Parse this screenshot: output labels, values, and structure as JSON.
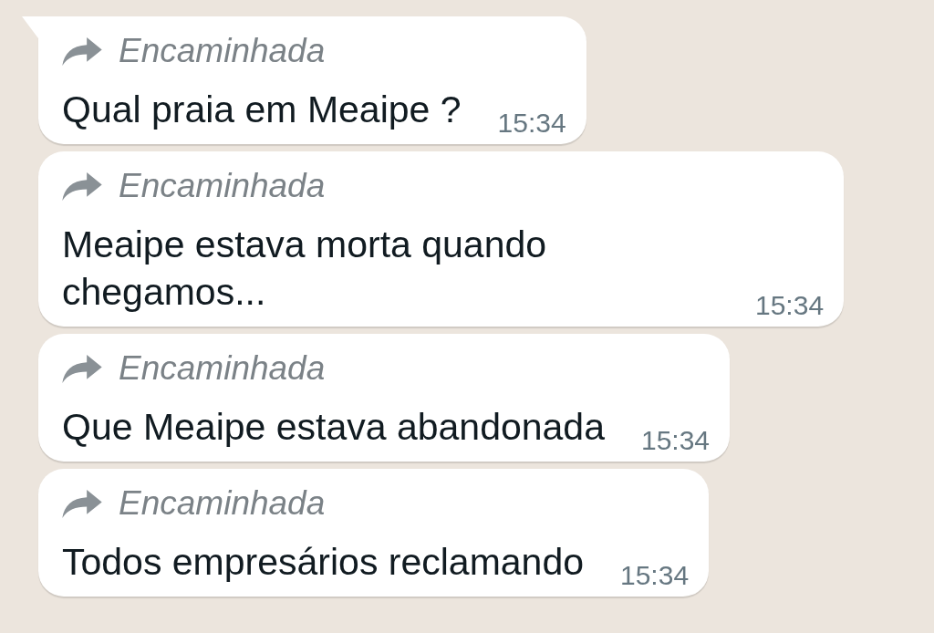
{
  "messages": [
    {
      "forwarded_label": "Encaminhada",
      "text": "Qual praia em Meaipe ?",
      "time": "15:34",
      "tail": true
    },
    {
      "forwarded_label": "Encaminhada",
      "text": "Meaipe estava morta quando chegamos...",
      "time": "15:34",
      "tail": false
    },
    {
      "forwarded_label": "Encaminhada",
      "text": "Que Meaipe estava abandonada",
      "time": "15:34",
      "tail": false
    },
    {
      "forwarded_label": "Encaminhada",
      "text": "Todos empresários reclamando",
      "time": "15:34",
      "tail": false
    }
  ]
}
